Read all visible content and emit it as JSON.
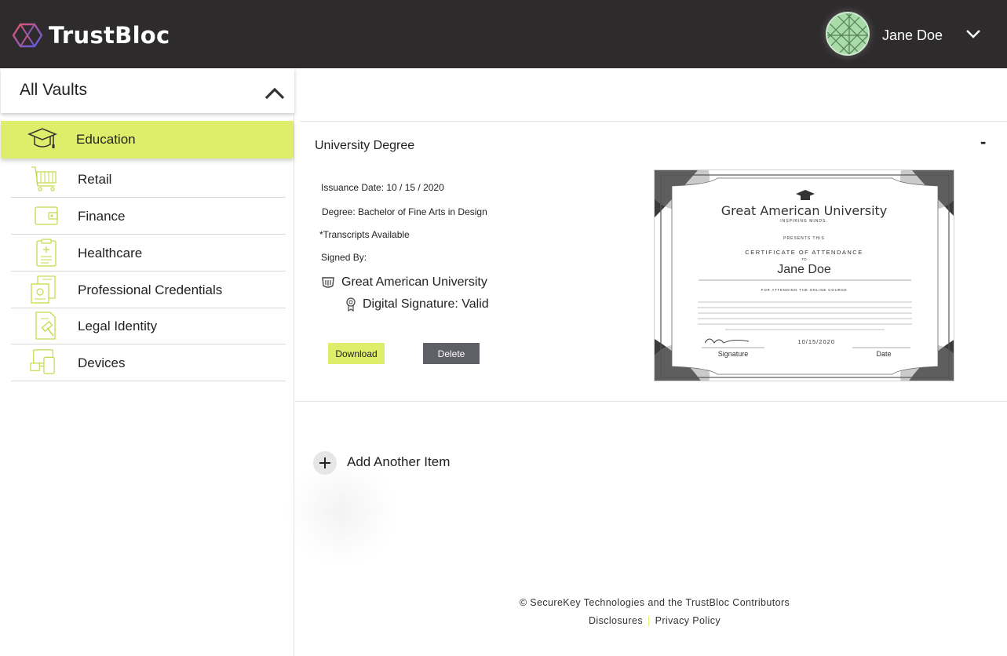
{
  "header": {
    "brand": "TrustBloc",
    "user_name": "Jane Doe"
  },
  "sidebar": {
    "vault_selector_label": "All Vaults",
    "items": [
      {
        "label": "Education",
        "icon": "graduation-cap-icon",
        "active": true
      },
      {
        "label": "Retail",
        "icon": "shopping-cart-icon"
      },
      {
        "label": "Finance",
        "icon": "wallet-icon"
      },
      {
        "label": "Healthcare",
        "icon": "clipboard-medical-icon"
      },
      {
        "label": "Professional Credentials",
        "icon": "id-badge-icon"
      },
      {
        "label": "Legal Identity",
        "icon": "gavel-document-icon"
      },
      {
        "label": "Devices",
        "icon": "devices-icon"
      }
    ]
  },
  "credential": {
    "title": "University Degree",
    "collapse_symbol": "-",
    "issuance_date": "Issuance Date: 10 / 15 / 2020",
    "degree": "Degree: Bachelor of Fine Arts in Design",
    "transcripts": "*Transcripts Available",
    "signed_by_label": "Signed By:",
    "signer": "Great American University",
    "signature_status": "Digital Signature: Valid",
    "download_label": "Download",
    "delete_label": "Delete",
    "certificate": {
      "university": "Great American University",
      "motto": "INSPIRING MINDS.",
      "presents": "PRESENTS THIS",
      "certificate_title": "CERTIFICATE OF ATTENDANCE",
      "to": "TO",
      "recipient": "Jane Doe",
      "course_line": "FOR ATTENDING THE ONLINE COURSE",
      "date": "10/15/2020",
      "signature_label": "Signature",
      "date_label": "Date"
    }
  },
  "add_item_label": "Add Another Item",
  "footer": {
    "copyright": "© SecureKey Technologies and the TrustBloc Contributors",
    "disclosures": "Disclosures",
    "separator": "|",
    "privacy": "Privacy Policy"
  },
  "colors": {
    "accent": "#dfee6a",
    "header_bg": "#2d2b2b",
    "delete_bg": "#5e5f67"
  }
}
